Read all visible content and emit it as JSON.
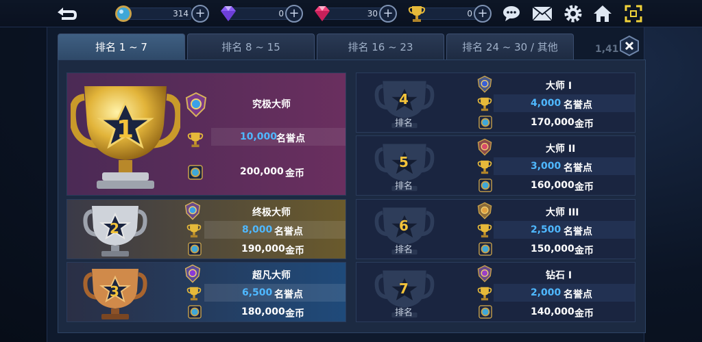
{
  "resources": [
    {
      "name": "coin",
      "value": "314",
      "icon": "coin-icon",
      "plus": "+"
    },
    {
      "name": "purple-gem",
      "value": "0",
      "icon": "purple-gem-icon",
      "plus": "+"
    },
    {
      "name": "pink-gem",
      "value": "30",
      "icon": "pink-gem-icon",
      "plus": "+"
    },
    {
      "name": "trophy",
      "value": "0",
      "icon": "trophy-icon",
      "plus": "+"
    }
  ],
  "toolbar_icons": [
    "chat-icon",
    "mail-icon",
    "settings-icon",
    "home-icon",
    "fullscreen-icon"
  ],
  "tabs": [
    {
      "label": "排名 1 ~ 7",
      "active": true
    },
    {
      "label": "排名 8 ~ 15",
      "active": false
    },
    {
      "label": "排名 16 ~ 23",
      "active": false
    },
    {
      "label": "排名 24 ~ 30 / 其他",
      "active": false
    }
  ],
  "peek_text": "1,41",
  "rank_label": "排名",
  "units": {
    "honor": "名誉点",
    "gold": "金币"
  },
  "ranks": [
    {
      "rank": "1",
      "title": "究极大师",
      "honor": "10,000",
      "gold": "200,000",
      "trophy": "gold"
    },
    {
      "rank": "2",
      "title": "终极大师",
      "honor": "8,000",
      "gold": "190,000",
      "trophy": "silver"
    },
    {
      "rank": "3",
      "title": "超凡大师",
      "honor": "6,500",
      "gold": "180,000",
      "trophy": "bronze"
    },
    {
      "rank": "4",
      "title": "大师 I",
      "honor": "4,000",
      "gold": "170,000"
    },
    {
      "rank": "5",
      "title": "大师 II",
      "honor": "3,000",
      "gold": "160,000"
    },
    {
      "rank": "6",
      "title": "大师 III",
      "honor": "2,500",
      "gold": "150,000"
    },
    {
      "rank": "7",
      "title": "钻石 I",
      "honor": "2,000",
      "gold": "140,000"
    }
  ],
  "colors": {
    "honor_number": "#4fb8ff",
    "rank_number": "#f3c33a",
    "card1": "#5a2d5c",
    "card2": "#6a5a2c",
    "card3": "#1f4a7a"
  }
}
